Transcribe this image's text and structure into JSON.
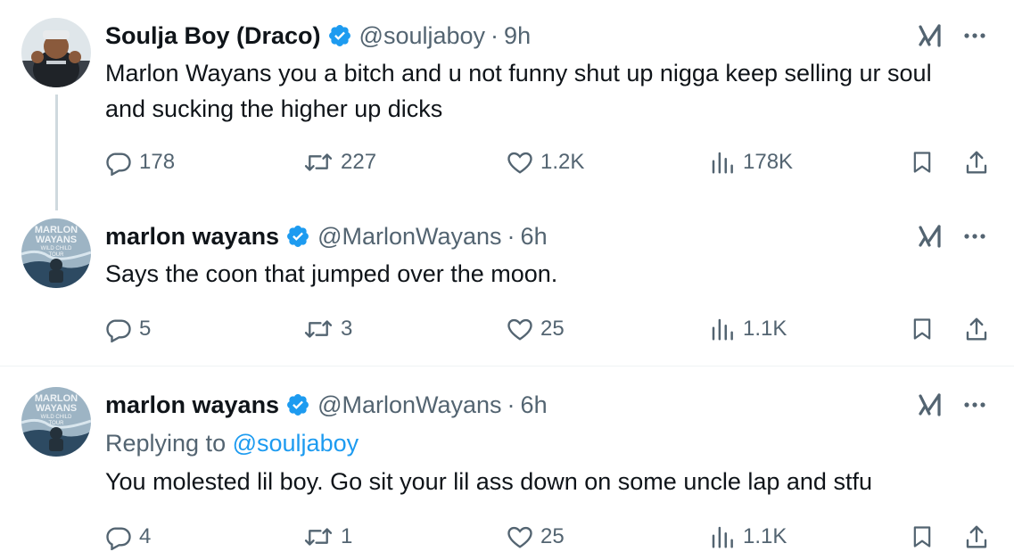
{
  "tweets": [
    {
      "name": "Soulja Boy (Draco)",
      "handle": "@souljaboy",
      "separator": "·",
      "time": "9h",
      "replying_label": "",
      "replying_handle": "",
      "text": "Marlon Wayans you a bitch and u not funny shut up nigga keep selling ur soul and sucking the higher up  dicks",
      "stats": {
        "replies": "178",
        "reposts": "227",
        "likes": "1.2K",
        "views": "178K"
      }
    },
    {
      "name": "marlon wayans",
      "handle": "@MarlonWayans",
      "separator": "·",
      "time": "6h",
      "replying_label": "",
      "replying_handle": "",
      "text": "Says the coon that jumped over the moon.",
      "stats": {
        "replies": "5",
        "reposts": "3",
        "likes": "25",
        "views": "1.1K"
      }
    },
    {
      "name": "marlon wayans",
      "handle": "@MarlonWayans",
      "separator": "·",
      "time": "6h",
      "replying_label": "Replying to",
      "replying_handle": "@souljaboy",
      "text": "You molested lil boy. Go sit your lil ass down on some uncle lap and stfu",
      "stats": {
        "replies": "4",
        "reposts": "1",
        "likes": "25",
        "views": "1.1K"
      }
    }
  ],
  "avatars": {
    "marlon_lines": [
      "MARLON",
      "WAYANS",
      "WILD CHILD",
      "TOUR"
    ]
  },
  "icons": {
    "verified": "verified-badge-icon",
    "grok": "grok-icon",
    "more": "more-icon",
    "reply": "reply-icon",
    "repost": "repost-icon",
    "like": "like-icon",
    "views": "views-icon",
    "bookmark": "bookmark-icon",
    "share": "share-icon"
  },
  "colors": {
    "text": "#0f1419",
    "muted": "#536471",
    "verified": "#1d9bf0",
    "link": "#1d9bf0",
    "thread_line": "#cfd9de"
  }
}
